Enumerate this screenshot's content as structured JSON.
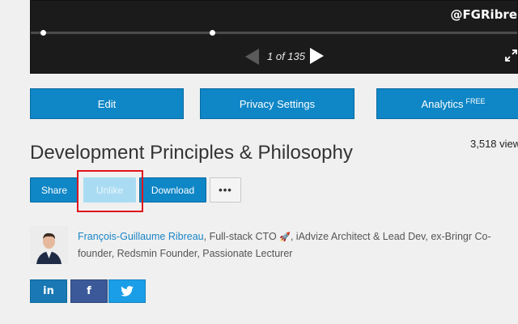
{
  "player": {
    "handle": "@FGRibre",
    "page_counter": "1 of 135",
    "progress_fraction": 0.0
  },
  "actions": {
    "edit": "Edit",
    "privacy": "Privacy Settings",
    "analytics": "Analytics",
    "analytics_badge": "FREE"
  },
  "presentation": {
    "title": "Development Principles & Philosophy",
    "views": "3,518 view"
  },
  "buttons": {
    "share": "Share",
    "unlike": "Unlike",
    "download": "Download",
    "more": "•••"
  },
  "author": {
    "name": "François-Guillaume Ribreau",
    "bio_part1": ", Full-stack CTO ",
    "bio_emoji": "🚀",
    "bio_part2": ", iAdvize Architect & Lead Dev, ex-Bringr Co-founder, Redsmin Founder, Passionate Lecturer"
  },
  "social": {
    "linkedin": "in",
    "facebook": "f",
    "twitter_icon": "twitter-bird"
  },
  "colors": {
    "primary": "#0f86c6",
    "unlike_disabled": "#a9dcf3",
    "highlight": "#e0141b",
    "link": "#1a85c7"
  }
}
